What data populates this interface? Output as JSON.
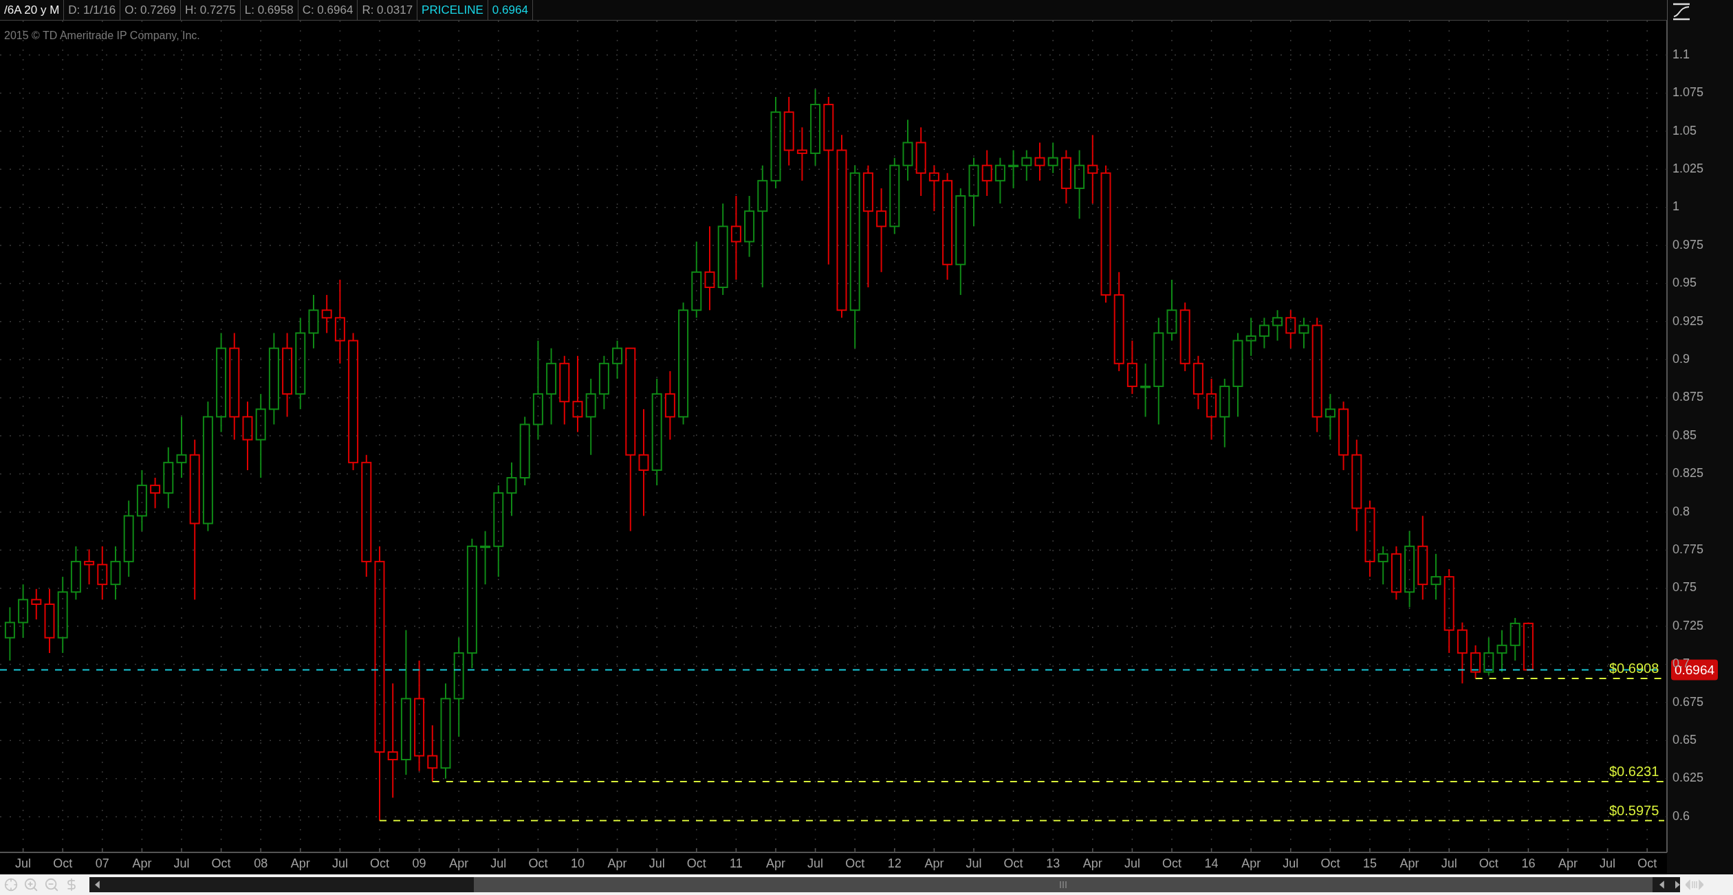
{
  "header": {
    "fields": [
      {
        "kind": "symbol",
        "text": "/6A 20 y M"
      },
      {
        "kind": "stat",
        "text": "D: 1/1/16"
      },
      {
        "kind": "stat",
        "text": "O: 0.7269"
      },
      {
        "kind": "stat",
        "text": "H: 0.7275"
      },
      {
        "kind": "stat",
        "text": "L: 0.6958"
      },
      {
        "kind": "stat",
        "text": "C: 0.6964"
      },
      {
        "kind": "stat",
        "text": "R: 0.0317"
      },
      {
        "kind": "study",
        "text": "PRICELINE"
      },
      {
        "kind": "study_value",
        "text": "0.6964"
      }
    ]
  },
  "copyright": "2015 © TD Ameritrade IP Company, Inc.",
  "chart": {
    "chart_data": {
      "type": "candlestick",
      "grid": true,
      "ylim": [
        0.5766,
        1.1361
      ],
      "yticks": [
        {
          "value": 0.6,
          "label": "0.6"
        },
        {
          "value": 0.625,
          "label": "0.625"
        },
        {
          "value": 0.65,
          "label": "0.65"
        },
        {
          "value": 0.675,
          "label": "0.675"
        },
        {
          "value": 0.7,
          "label": "0.7"
        },
        {
          "value": 0.725,
          "label": "0.725"
        },
        {
          "value": 0.75,
          "label": "0.75"
        },
        {
          "value": 0.775,
          "label": "0.775"
        },
        {
          "value": 0.8,
          "label": "0.8"
        },
        {
          "value": 0.825,
          "label": "0.825"
        },
        {
          "value": 0.85,
          "label": "0.85"
        },
        {
          "value": 0.875,
          "label": "0.875"
        },
        {
          "value": 0.9,
          "label": "0.9"
        },
        {
          "value": 0.925,
          "label": "0.925"
        },
        {
          "value": 0.95,
          "label": "0.95"
        },
        {
          "value": 0.975,
          "label": "0.975"
        },
        {
          "value": 1,
          "label": "1"
        },
        {
          "value": 1.025,
          "label": "1.025"
        },
        {
          "value": 1.05,
          "label": "1.05"
        },
        {
          "value": 1.075,
          "label": "1.075"
        },
        {
          "value": 1.1,
          "label": "1.1"
        }
      ],
      "categories": [
        null,
        "Jul",
        null,
        null,
        "Oct",
        null,
        null,
        "07",
        null,
        null,
        "Apr",
        null,
        null,
        "Jul",
        null,
        null,
        "Oct",
        null,
        null,
        "08",
        null,
        null,
        "Apr",
        null,
        null,
        "Jul",
        null,
        null,
        "Oct",
        null,
        null,
        "09",
        null,
        null,
        "Apr",
        null,
        null,
        "Jul",
        null,
        null,
        "Oct",
        null,
        null,
        "10",
        null,
        null,
        "Apr",
        null,
        null,
        "Jul",
        null,
        null,
        "Oct",
        null,
        null,
        "11",
        null,
        null,
        "Apr",
        null,
        null,
        "Jul",
        null,
        null,
        "Oct",
        null,
        null,
        "12",
        null,
        null,
        "Apr",
        null,
        null,
        "Jul",
        null,
        null,
        "Oct",
        null,
        null,
        "13",
        null,
        null,
        "Apr",
        null,
        null,
        "Jul",
        null,
        null,
        "Oct",
        null,
        null,
        "14",
        null,
        null,
        "Apr",
        null,
        null,
        "Jul",
        null,
        null,
        "Oct",
        null,
        null,
        "15",
        null,
        null,
        "Apr",
        null,
        null,
        "Jul",
        null,
        null,
        "Oct",
        null,
        null,
        "16",
        null,
        null,
        "Apr",
        null,
        null,
        "Jul",
        null,
        null,
        "Oct"
      ],
      "ohlc": [
        [
          0.7175,
          0.7375,
          0.7025,
          0.7275
        ],
        [
          0.7275,
          0.7525,
          0.7175,
          0.7425
        ],
        [
          0.7425,
          0.7495,
          0.7295,
          0.7395
        ],
        [
          0.7395,
          0.7495,
          0.7075,
          0.7175
        ],
        [
          0.7175,
          0.7575,
          0.7075,
          0.7475
        ],
        [
          0.7475,
          0.7775,
          0.7425,
          0.7675
        ],
        [
          0.7675,
          0.7755,
          0.7525,
          0.7655
        ],
        [
          0.7655,
          0.7775,
          0.7425,
          0.7525
        ],
        [
          0.7525,
          0.7775,
          0.7425,
          0.7675
        ],
        [
          0.7675,
          0.8075,
          0.7575,
          0.7975
        ],
        [
          0.7975,
          0.8275,
          0.7875,
          0.8175
        ],
        [
          0.8175,
          0.8225,
          0.8025,
          0.8125
        ],
        [
          0.8125,
          0.8425,
          0.8025,
          0.8325
        ],
        [
          0.8325,
          0.8625,
          0.8225,
          0.8375
        ],
        [
          0.8375,
          0.8475,
          0.7425,
          0.7925
        ],
        [
          0.7925,
          0.8725,
          0.7875,
          0.8625
        ],
        [
          0.8625,
          0.9175,
          0.8525,
          0.9075
        ],
        [
          0.9075,
          0.9175,
          0.8475,
          0.8625
        ],
        [
          0.8625,
          0.8725,
          0.8275,
          0.8475
        ],
        [
          0.8475,
          0.8775,
          0.8225,
          0.8675
        ],
        [
          0.8675,
          0.9175,
          0.8575,
          0.9075
        ],
        [
          0.9075,
          0.9175,
          0.8625,
          0.8775
        ],
        [
          0.8775,
          0.9275,
          0.8675,
          0.9175
        ],
        [
          0.9175,
          0.9425,
          0.9075,
          0.9325
        ],
        [
          0.9325,
          0.9425,
          0.9175,
          0.9275
        ],
        [
          0.9275,
          0.9525,
          0.8975,
          0.9125
        ],
        [
          0.9125,
          0.9175,
          0.8275,
          0.8325
        ],
        [
          0.8325,
          0.8375,
          0.7575,
          0.7675
        ],
        [
          0.7675,
          0.7775,
          0.5975,
          0.6425
        ],
        [
          0.6425,
          0.6875,
          0.6125,
          0.6375
        ],
        [
          0.6375,
          0.7225,
          0.6275,
          0.6775
        ],
        [
          0.6775,
          0.7025,
          0.63,
          0.64
        ],
        [
          0.64,
          0.66,
          0.6231,
          0.632
        ],
        [
          0.632,
          0.6875,
          0.625,
          0.6775
        ],
        [
          0.6775,
          0.7175,
          0.6525,
          0.7075
        ],
        [
          0.7075,
          0.7825,
          0.6975,
          0.7775
        ],
        [
          0.7775,
          0.7875,
          0.7525,
          0.7775
        ],
        [
          0.7775,
          0.8175,
          0.7575,
          0.8125
        ],
        [
          0.8125,
          0.8325,
          0.7975,
          0.8225
        ],
        [
          0.8225,
          0.8625,
          0.8175,
          0.8575
        ],
        [
          0.8575,
          0.9125,
          0.8475,
          0.8775
        ],
        [
          0.8775,
          0.9075,
          0.8575,
          0.8975
        ],
        [
          0.8975,
          0.9025,
          0.8575,
          0.8725
        ],
        [
          0.8725,
          0.9025,
          0.8525,
          0.8625
        ],
        [
          0.8625,
          0.8875,
          0.8375,
          0.8775
        ],
        [
          0.8775,
          0.9025,
          0.8675,
          0.8975
        ],
        [
          0.8975,
          0.9125,
          0.8875,
          0.9075
        ],
        [
          0.9075,
          0.9075,
          0.7875,
          0.8375
        ],
        [
          0.8375,
          0.8675,
          0.7975,
          0.8275
        ],
        [
          0.8275,
          0.8875,
          0.8175,
          0.8775
        ],
        [
          0.8775,
          0.8925,
          0.8475,
          0.8625
        ],
        [
          0.8625,
          0.9375,
          0.8575,
          0.9325
        ],
        [
          0.9325,
          0.9775,
          0.9275,
          0.9575
        ],
        [
          0.9575,
          0.9875,
          0.9325,
          0.9475
        ],
        [
          0.9475,
          1.0025,
          0.9425,
          0.9875
        ],
        [
          0.9875,
          1.0075,
          0.9525,
          0.9775
        ],
        [
          0.9775,
          1.0075,
          0.9675,
          0.9975
        ],
        [
          0.9975,
          1.0275,
          0.9475,
          1.0175
        ],
        [
          1.0175,
          1.0725,
          1.0125,
          1.0625
        ],
        [
          1.0625,
          1.0725,
          1.0275,
          1.0375
        ],
        [
          1.0375,
          1.0525,
          1.0175,
          1.0355
        ],
        [
          1.0355,
          1.0775,
          1.0275,
          1.0675
        ],
        [
          1.0675,
          1.0725,
          0.9625,
          1.0375
        ],
        [
          1.0375,
          1.0475,
          0.9275,
          0.9325
        ],
        [
          0.9325,
          1.0275,
          0.9075,
          1.0225
        ],
        [
          1.0225,
          1.0275,
          0.9475,
          0.9975
        ],
        [
          0.9975,
          1.0125,
          0.9575,
          0.9875
        ],
        [
          0.9875,
          1.0325,
          0.9825,
          1.0275
        ],
        [
          1.0275,
          1.0575,
          1.0175,
          1.0425
        ],
        [
          1.0425,
          1.0525,
          1.0075,
          1.0225
        ],
        [
          1.0225,
          1.0275,
          0.9975,
          1.0175
        ],
        [
          1.0175,
          1.0225,
          0.9525,
          0.9625
        ],
        [
          0.9625,
          1.0125,
          0.9425,
          1.0075
        ],
        [
          1.0075,
          1.0325,
          0.9875,
          1.0275
        ],
        [
          1.0275,
          1.0375,
          1.0075,
          1.0175
        ],
        [
          1.0175,
          1.0325,
          1.0025,
          1.0275
        ],
        [
          1.0275,
          1.0375,
          1.0125,
          1.0275
        ],
        [
          1.0275,
          1.0375,
          1.0175,
          1.0325
        ],
        [
          1.0325,
          1.0425,
          1.0175,
          1.0275
        ],
        [
          1.0275,
          1.0425,
          1.0225,
          1.0325
        ],
        [
          1.0325,
          1.0375,
          1.0025,
          1.0125
        ],
        [
          1.0125,
          1.0375,
          0.9925,
          1.0275
        ],
        [
          1.0275,
          1.0475,
          1.0025,
          1.0225
        ],
        [
          1.0225,
          1.0275,
          0.9375,
          0.9425
        ],
        [
          0.9425,
          0.9575,
          0.8925,
          0.8975
        ],
        [
          0.8975,
          0.9125,
          0.8775,
          0.8825
        ],
        [
          0.8825,
          0.8975,
          0.8625,
          0.8825
        ],
        [
          0.8825,
          0.9275,
          0.8575,
          0.9175
        ],
        [
          0.9175,
          0.9525,
          0.9125,
          0.9325
        ],
        [
          0.9325,
          0.9375,
          0.8925,
          0.8975
        ],
        [
          0.8975,
          0.9025,
          0.8675,
          0.8775
        ],
        [
          0.8775,
          0.8875,
          0.8475,
          0.8625
        ],
        [
          0.8625,
          0.8875,
          0.8425,
          0.8825
        ],
        [
          0.8825,
          0.9175,
          0.8625,
          0.9125
        ],
        [
          0.9125,
          0.9275,
          0.9025,
          0.9155
        ],
        [
          0.9155,
          0.9275,
          0.9075,
          0.9225
        ],
        [
          0.9225,
          0.9325,
          0.9125,
          0.9275
        ],
        [
          0.9275,
          0.9325,
          0.9075,
          0.9175
        ],
        [
          0.9175,
          0.9275,
          0.9075,
          0.9225
        ],
        [
          0.9225,
          0.9275,
          0.8525,
          0.8625
        ],
        [
          0.8625,
          0.8775,
          0.8475,
          0.8675
        ],
        [
          0.8675,
          0.8725,
          0.8275,
          0.8375
        ],
        [
          0.8375,
          0.8475,
          0.7875,
          0.8025
        ],
        [
          0.8025,
          0.8075,
          0.7575,
          0.7675
        ],
        [
          0.7675,
          0.7775,
          0.7525,
          0.7725
        ],
        [
          0.7725,
          0.7775,
          0.7425,
          0.7475
        ],
        [
          0.7475,
          0.7875,
          0.7375,
          0.7775
        ],
        [
          0.7775,
          0.7975,
          0.7425,
          0.7525
        ],
        [
          0.7525,
          0.7725,
          0.7425,
          0.7575
        ],
        [
          0.7575,
          0.7625,
          0.7075,
          0.7225
        ],
        [
          0.7225,
          0.7275,
          0.6875,
          0.7075
        ],
        [
          0.7075,
          0.7125,
          0.6908,
          0.695
        ],
        [
          0.695,
          0.7175,
          0.693,
          0.7075
        ],
        [
          0.7075,
          0.7225,
          0.695,
          0.7125
        ],
        [
          0.7125,
          0.7305,
          0.7025,
          0.7269
        ],
        [
          0.7269,
          0.7275,
          0.6958,
          0.6964
        ],
        null,
        null,
        null,
        null,
        null,
        null,
        null,
        null,
        null
      ],
      "ref_lines": [
        {
          "axis": "y",
          "value": 0.6964,
          "color": "#19c8d8"
        },
        {
          "axis": "y",
          "value": 0.6908,
          "label": "$0.6908",
          "color": "#d8f03a"
        },
        {
          "axis": "y",
          "value": 0.6231,
          "label": "$0.6231",
          "color": "#d8f03a"
        },
        {
          "axis": "y",
          "value": 0.5975,
          "label": "$0.5975",
          "color": "#d8f03a"
        }
      ],
      "annotations": [
        "0.6964"
      ]
    }
  }
}
